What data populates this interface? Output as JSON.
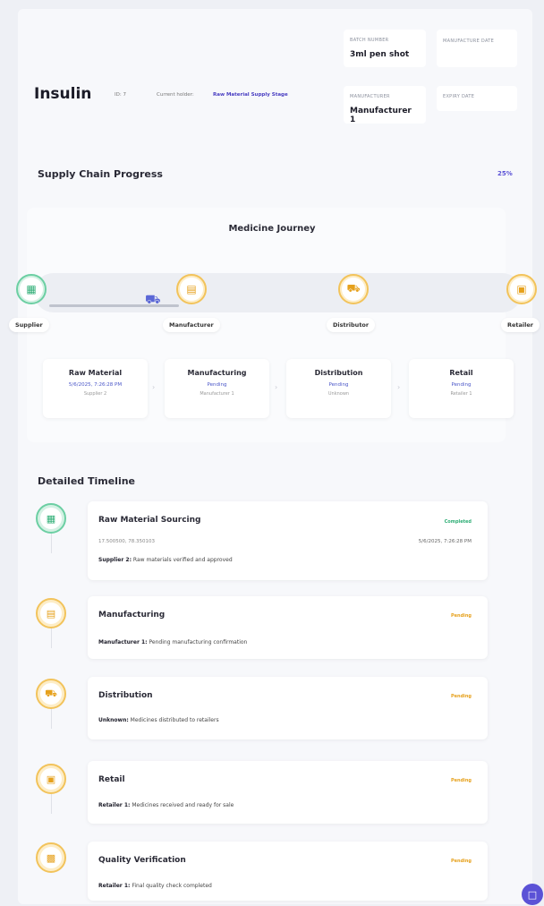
{
  "product": {
    "name": "Insulin",
    "id": "ID: 7",
    "holder_label": "Current holder:",
    "holder_value": "Raw Material Supply Stage"
  },
  "meta": {
    "batch_label": "BATCH NUMBER",
    "batch_value": "3ml pen shot",
    "mfg_date_label": "MANUFACTURE DATE",
    "manufacturer_label": "MANUFACTURER",
    "manufacturer_value": "Manufacturer 1",
    "expiry_label": "EXPIRY DATE"
  },
  "progress": {
    "title": "Supply Chain Progress",
    "percent_text": "25%",
    "fraction": 0.25
  },
  "journey": {
    "title": "Medicine Journey",
    "nodes": [
      {
        "label": "Supplier",
        "icon": "warehouse-icon"
      },
      {
        "label": "Manufacturer",
        "icon": "factory-icon"
      },
      {
        "label": "Distributor",
        "icon": "truck-icon"
      },
      {
        "label": "Retailer",
        "icon": "store-icon"
      }
    ],
    "stages": [
      {
        "title": "Raw Material",
        "status": "5/6/2025, 7:26:28 PM",
        "holder": "Supplier 2"
      },
      {
        "title": "Manufacturing",
        "status": "Pending",
        "holder": "Manufacturer 1"
      },
      {
        "title": "Distribution",
        "status": "Pending",
        "holder": "Unknown"
      },
      {
        "title": "Retail",
        "status": "Pending",
        "holder": "Retailer 1"
      }
    ]
  },
  "timeline": {
    "title": "Detailed Timeline",
    "items": [
      {
        "title": "Raw Material Sourcing",
        "status": "Completed",
        "coords": "17.500500, 78.350103",
        "date": "5/6/2025, 7:26:28 PM",
        "actor": "Supplier 2:",
        "desc": "Raw materials verified and approved",
        "icon": "warehouse-icon"
      },
      {
        "title": "Manufacturing",
        "status": "Pending",
        "actor": "Manufacturer 1:",
        "desc": "Pending manufacturing confirmation",
        "icon": "factory-icon"
      },
      {
        "title": "Distribution",
        "status": "Pending",
        "actor": "Unknown:",
        "desc": "Medicines distributed to retailers",
        "icon": "truck-icon"
      },
      {
        "title": "Retail",
        "status": "Pending",
        "actor": "Retailer 1:",
        "desc": "Medicines received and ready for sale",
        "icon": "store-icon"
      },
      {
        "title": "Quality Verification",
        "status": "Pending",
        "actor": "Retailer 1:",
        "desc": "Final quality check completed",
        "icon": "clipboard-icon"
      }
    ]
  },
  "colors": {
    "accent": "#5b52d6",
    "completed": "#2fae76",
    "pending": "#e6a11d"
  }
}
